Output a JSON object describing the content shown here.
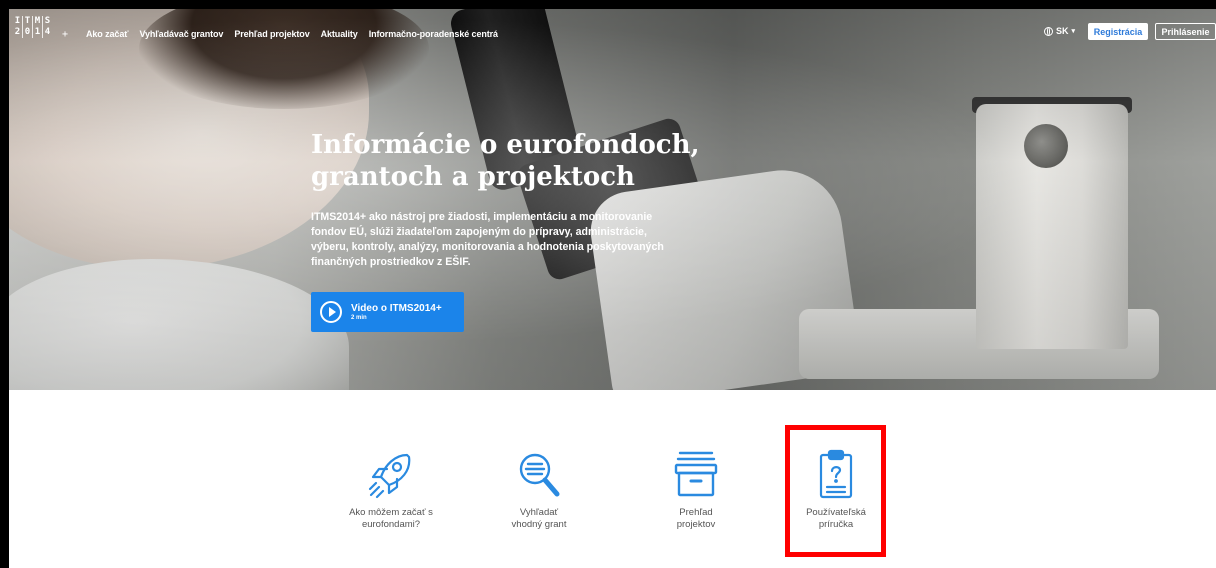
{
  "logo": {
    "top": [
      "I",
      "T",
      "M",
      "S"
    ],
    "bottom": [
      "2",
      "0",
      "1",
      "4"
    ],
    "plus": "+"
  },
  "nav": {
    "items": [
      "Ako začať",
      "Vyhľadávač grantov",
      "Prehľad projektov",
      "Aktuality",
      "Informačno-poradenské centrá"
    ],
    "language": "SK",
    "register": "Registrácia",
    "login": "Prihlásenie"
  },
  "hero": {
    "title_line1": "Informácie o eurofondoch,",
    "title_line2": "grantoch a projektoch",
    "description": "ITMS2014+ ako nástroj pre žiadosti, implementáciu a monitorovanie fondov EÚ, slúži žiadateľom zapojeným do prípravy, administrácie, výberu, kontroly, analýzy, monitorovania a hodnotenia poskytovaných finančných prostriedkov z EŠIF.",
    "video_title": "Video o ITMS2014+",
    "video_duration": "2 min"
  },
  "cards": [
    {
      "icon": "rocket-icon",
      "line1": "Ako môžem začať s",
      "line2": "eurofondami?"
    },
    {
      "icon": "magnifier-icon",
      "line1": "Vyhľadať",
      "line2": "vhodný grant"
    },
    {
      "icon": "archive-box-icon",
      "line1": "Prehľad",
      "line2": "projektov"
    },
    {
      "icon": "clipboard-question-icon",
      "line1": "Používateľská",
      "line2": "príručka"
    }
  ],
  "colors": {
    "accent": "#1b84ea",
    "icon_blue": "#2a8ae0",
    "highlight": "#ff0000"
  }
}
